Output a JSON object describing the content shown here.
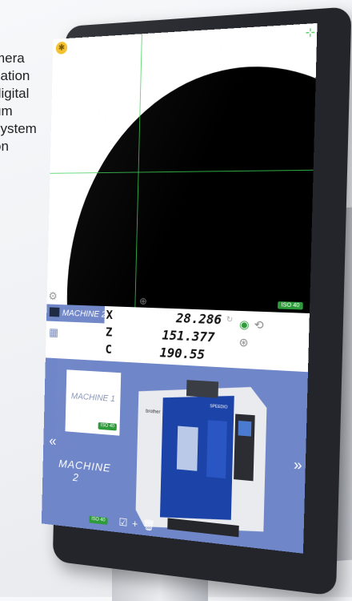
{
  "background_text": [
    "mera",
    "cation",
    "digital",
    "um",
    "system",
    "on"
  ],
  "camera": {
    "iso_badge": "ISO 40"
  },
  "header": {
    "machine_name": "MACHINE 2",
    "axes": [
      {
        "letter": "X",
        "value": "28.286"
      },
      {
        "letter": "Z",
        "value": "151.377"
      },
      {
        "letter": "C",
        "value": "190.55"
      }
    ]
  },
  "machines": {
    "card1_label": "MACHINE 1",
    "card1_iso": "ISO 40",
    "card2_label_line1": "MACHINE",
    "card2_label_line2": "2",
    "card2_iso": "ISO 40",
    "machine_brand": "brother",
    "machine_model": "SPEEDIO"
  },
  "toolbar": {
    "edit": "☑",
    "add": "+",
    "delete": "🗑",
    "more": "···"
  },
  "icons": {
    "nav_left": "«",
    "nav_right": "»"
  },
  "colors": {
    "accent_blue": "#6f86c8",
    "grid_green": "#3bcf52",
    "badge_green": "#2e9b3a",
    "bezel": "#23252b"
  }
}
